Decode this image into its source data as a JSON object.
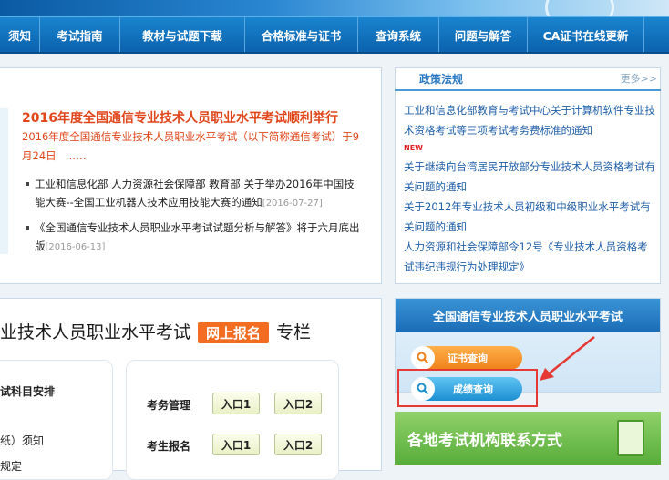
{
  "nav": [
    "须知",
    "考试指南",
    "教材与试题下载",
    "合格标准与证书",
    "查询系统",
    "问题与解答",
    "CA证书在线更新"
  ],
  "news": {
    "headline": "2016年度全国通信专业技术人员职业水平考试顺利举行",
    "summary": "2016年度全国通信专业技术人员职业水平考试（以下简称通信考试）于9月24日",
    "more": "……",
    "items": [
      {
        "text": "工业和信息化部 人力资源社会保障部 教育部 关于举办2016年中国技能大赛--全国工业机器人技术应用技能大赛的通知",
        "date": "[2016-07-27]"
      },
      {
        "text": "《全国通信专业技术人员职业水平考试试题分析与解答》将于六月底出版",
        "date": "[2016-06-13]"
      }
    ]
  },
  "column": {
    "title_left": "业技术人员职业水平考试",
    "register": "网上报名",
    "title_right": "专栏",
    "subjects_label": "试科目安排",
    "notice_label": "纸）须知",
    "rule_label": "规定"
  },
  "entries": {
    "exam_mgmt": "考务管理",
    "student_reg": "考生报名",
    "entry1": "入口1",
    "entry2": "入口2"
  },
  "policy": {
    "title": "政策法规",
    "more": "更多>>",
    "items": [
      "工业和信息化部教育与考试中心关于计算机软件专业技术资格考试等三项考试考务费标准的通知",
      "关于继续向台湾居民开放部分专业技术人员资格考试有关问题的通知",
      "关于2012年专业技术人员初级和中级职业水平考试有关问题的通知",
      "人力资源和社会保障部令12号《专业技术人员资格考试违纪违规行为处理规定》"
    ],
    "new_tag": "NEW"
  },
  "exam": {
    "title": "全国通信专业技术人员职业水平考试",
    "cert_query": "证书查询",
    "score_query": "成绩查询"
  },
  "contact": "各地考试机构联系方式",
  "colors": {
    "nav": "#0b62ad",
    "accent_orange": "#f26d21",
    "headline_red": "#e0461a",
    "highlight_red": "#e53935",
    "green": "#58ad3a"
  }
}
